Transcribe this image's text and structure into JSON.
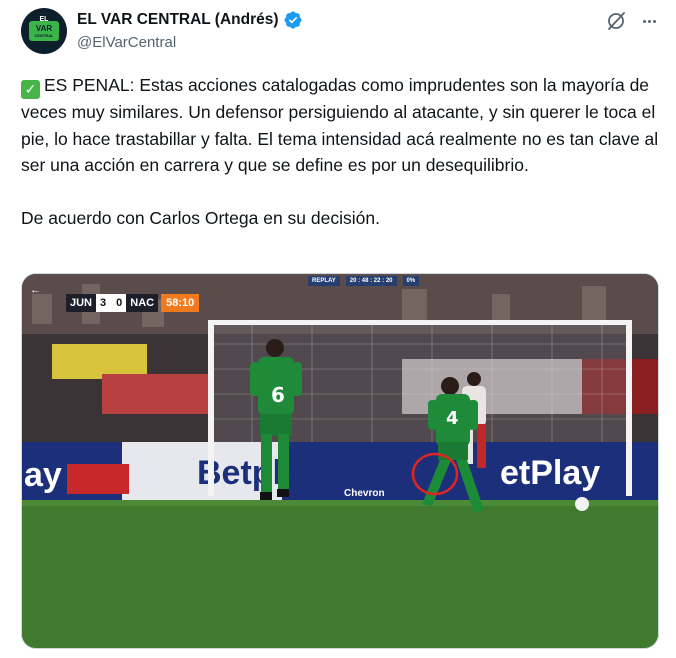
{
  "header": {
    "display_name": "EL VAR CENTRAL (Andrés)",
    "handle": "@ElVarCentral",
    "avatar_text_top": "EL",
    "avatar_text_main": "VAR",
    "avatar_text_sub": "CENTRAL",
    "verified_icon": "verified-badge-icon",
    "grok_icon": "grok-icon",
    "more_icon": "more-options-icon"
  },
  "tweet": {
    "check_emoji": "✓",
    "paragraph_1": "ES PENAL: Estas acciones catalogadas como imprudentes son la mayoría de veces muy similares. Un defensor persiguiendo al atacante, y sin querer le toca el pie, lo hace trastabillar y falta. El tema intensidad acá realmente no es tan clave al ser una acción en carrera y que se define es por un desequilibrio.",
    "paragraph_2": "De acuerdo con Carlos Ortega en su decisión."
  },
  "media": {
    "scorebug": {
      "home": "JUN",
      "home_score": "3",
      "away_score": "0",
      "away": "NAC",
      "clock": "58:10"
    },
    "var_bar": {
      "label": "REPLAY",
      "timecode": "20 : 48 : 22 : 20",
      "rate": "0%"
    },
    "player_left_number": "6",
    "player_right_number": "4",
    "ad_text_left": "ay",
    "ad_text_center": "Betplay",
    "ad_text_right": "etPlay",
    "ad_text_chevron": "Chevron",
    "colors": {
      "pitch": "#3f7a2e",
      "kit_green": "#1f8a3a",
      "ad_blue": "#1b2f7a",
      "highlight_circle": "#e02424"
    }
  }
}
